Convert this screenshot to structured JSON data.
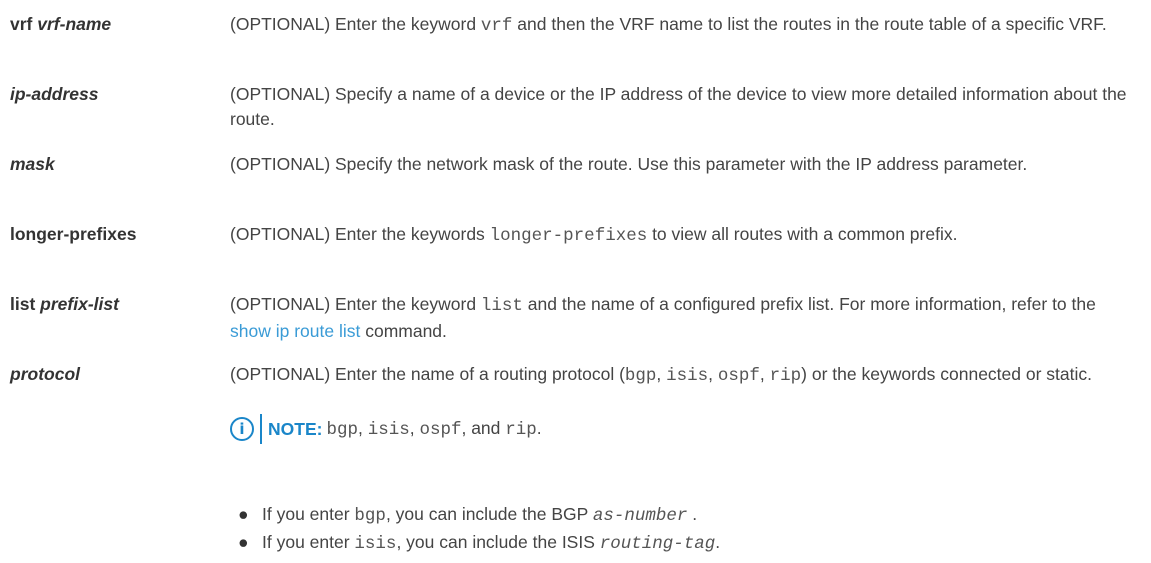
{
  "params": [
    {
      "term_plain": "vrf",
      "term_italic": "vrf-name",
      "desc": [
        {
          "t": "text",
          "v": "(OPTIONAL) Enter the keyword "
        },
        {
          "t": "mono",
          "v": "vrf"
        },
        {
          "t": "text",
          "v": " and then the VRF name to list the routes in the route table of a specific VRF."
        }
      ]
    },
    {
      "term_plain": "",
      "term_italic": "ip-address",
      "desc": [
        {
          "t": "text",
          "v": "(OPTIONAL) Specify a name of a device or the IP address of the device to view more detailed information about the route."
        }
      ]
    },
    {
      "term_plain": "",
      "term_italic": "mask",
      "desc": [
        {
          "t": "text",
          "v": "(OPTIONAL) Specify the network mask of the route. Use this parameter with the IP address parameter."
        }
      ]
    },
    {
      "term_plain": "longer-prefixes",
      "term_italic": "",
      "desc": [
        {
          "t": "text",
          "v": "(OPTIONAL) Enter the keywords "
        },
        {
          "t": "mono",
          "v": "longer-prefixes"
        },
        {
          "t": "text",
          "v": " to view all routes with a common prefix."
        }
      ]
    },
    {
      "term_plain": "list",
      "term_italic": "prefix-list",
      "desc": [
        {
          "t": "text",
          "v": "(OPTIONAL) Enter the keyword "
        },
        {
          "t": "mono",
          "v": "list"
        },
        {
          "t": "text",
          "v": " and the name of a configured prefix list. For more information, refer to the "
        },
        {
          "t": "link",
          "v": "show ip route list"
        },
        {
          "t": "text",
          "v": " command."
        }
      ]
    },
    {
      "term_plain": "",
      "term_italic": "protocol",
      "desc": [
        {
          "t": "text",
          "v": "(OPTIONAL) Enter the name of a routing protocol ("
        },
        {
          "t": "mono",
          "v": "bgp"
        },
        {
          "t": "text",
          "v": ", "
        },
        {
          "t": "mono",
          "v": "isis"
        },
        {
          "t": "text",
          "v": ", "
        },
        {
          "t": "mono",
          "v": "ospf"
        },
        {
          "t": "text",
          "v": ", "
        },
        {
          "t": "mono",
          "v": "rip"
        },
        {
          "t": "text",
          "v": ") or the keywords connected or static."
        }
      ]
    }
  ],
  "note": {
    "icon": "info-icon",
    "icon_glyph": "i",
    "label": "NOTE:",
    "content": [
      {
        "t": "mono",
        "v": "bgp"
      },
      {
        "t": "text",
        "v": ", "
      },
      {
        "t": "mono",
        "v": "isis"
      },
      {
        "t": "text",
        "v": ", "
      },
      {
        "t": "mono",
        "v": "ospf"
      },
      {
        "t": "text",
        "v": ", and "
      },
      {
        "t": "mono",
        "v": "rip"
      },
      {
        "t": "text",
        "v": "."
      }
    ]
  },
  "bullets": [
    [
      {
        "t": "text",
        "v": "If you enter "
      },
      {
        "t": "mono",
        "v": "bgp"
      },
      {
        "t": "text",
        "v": ", you can include the BGP "
      },
      {
        "t": "mono-it",
        "v": "as-number"
      },
      {
        "t": "text",
        "v": " ."
      }
    ],
    [
      {
        "t": "text",
        "v": "If you enter "
      },
      {
        "t": "mono",
        "v": "isis"
      },
      {
        "t": "text",
        "v": ", you can include the ISIS "
      },
      {
        "t": "mono-it",
        "v": "routing-tag"
      },
      {
        "t": "text",
        "v": "."
      }
    ]
  ],
  "colors": {
    "text": "#444444",
    "link": "#3a9bd6",
    "note_accent": "#1a86c9"
  }
}
